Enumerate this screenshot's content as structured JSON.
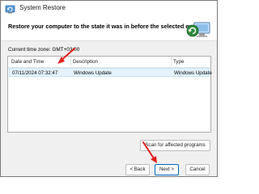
{
  "window": {
    "title": "System Restore",
    "heading": "Restore your computer to the state it was in before the selected event"
  },
  "timezone": {
    "label": "Current time zone: GMT+03:00"
  },
  "table": {
    "columns": [
      "Date and Time",
      "Description",
      "Type"
    ],
    "rows": [
      {
        "date_time": "07/11/2024 07:32:47",
        "description": "Windows Update",
        "type": "Windows Update",
        "selected": true
      }
    ]
  },
  "buttons": {
    "scan": "Scan for affected programs",
    "back": "< Back",
    "next": "Next >",
    "cancel": "Cancel"
  },
  "icons": {
    "app": "system-restore-icon",
    "header": "restore-graphic-icon",
    "annotation": "red-arrow-icon"
  },
  "colors": {
    "annotation_arrow": "#e0201b",
    "selected_row": "#e5f3ff",
    "primary_button_border": "#0067c0"
  }
}
